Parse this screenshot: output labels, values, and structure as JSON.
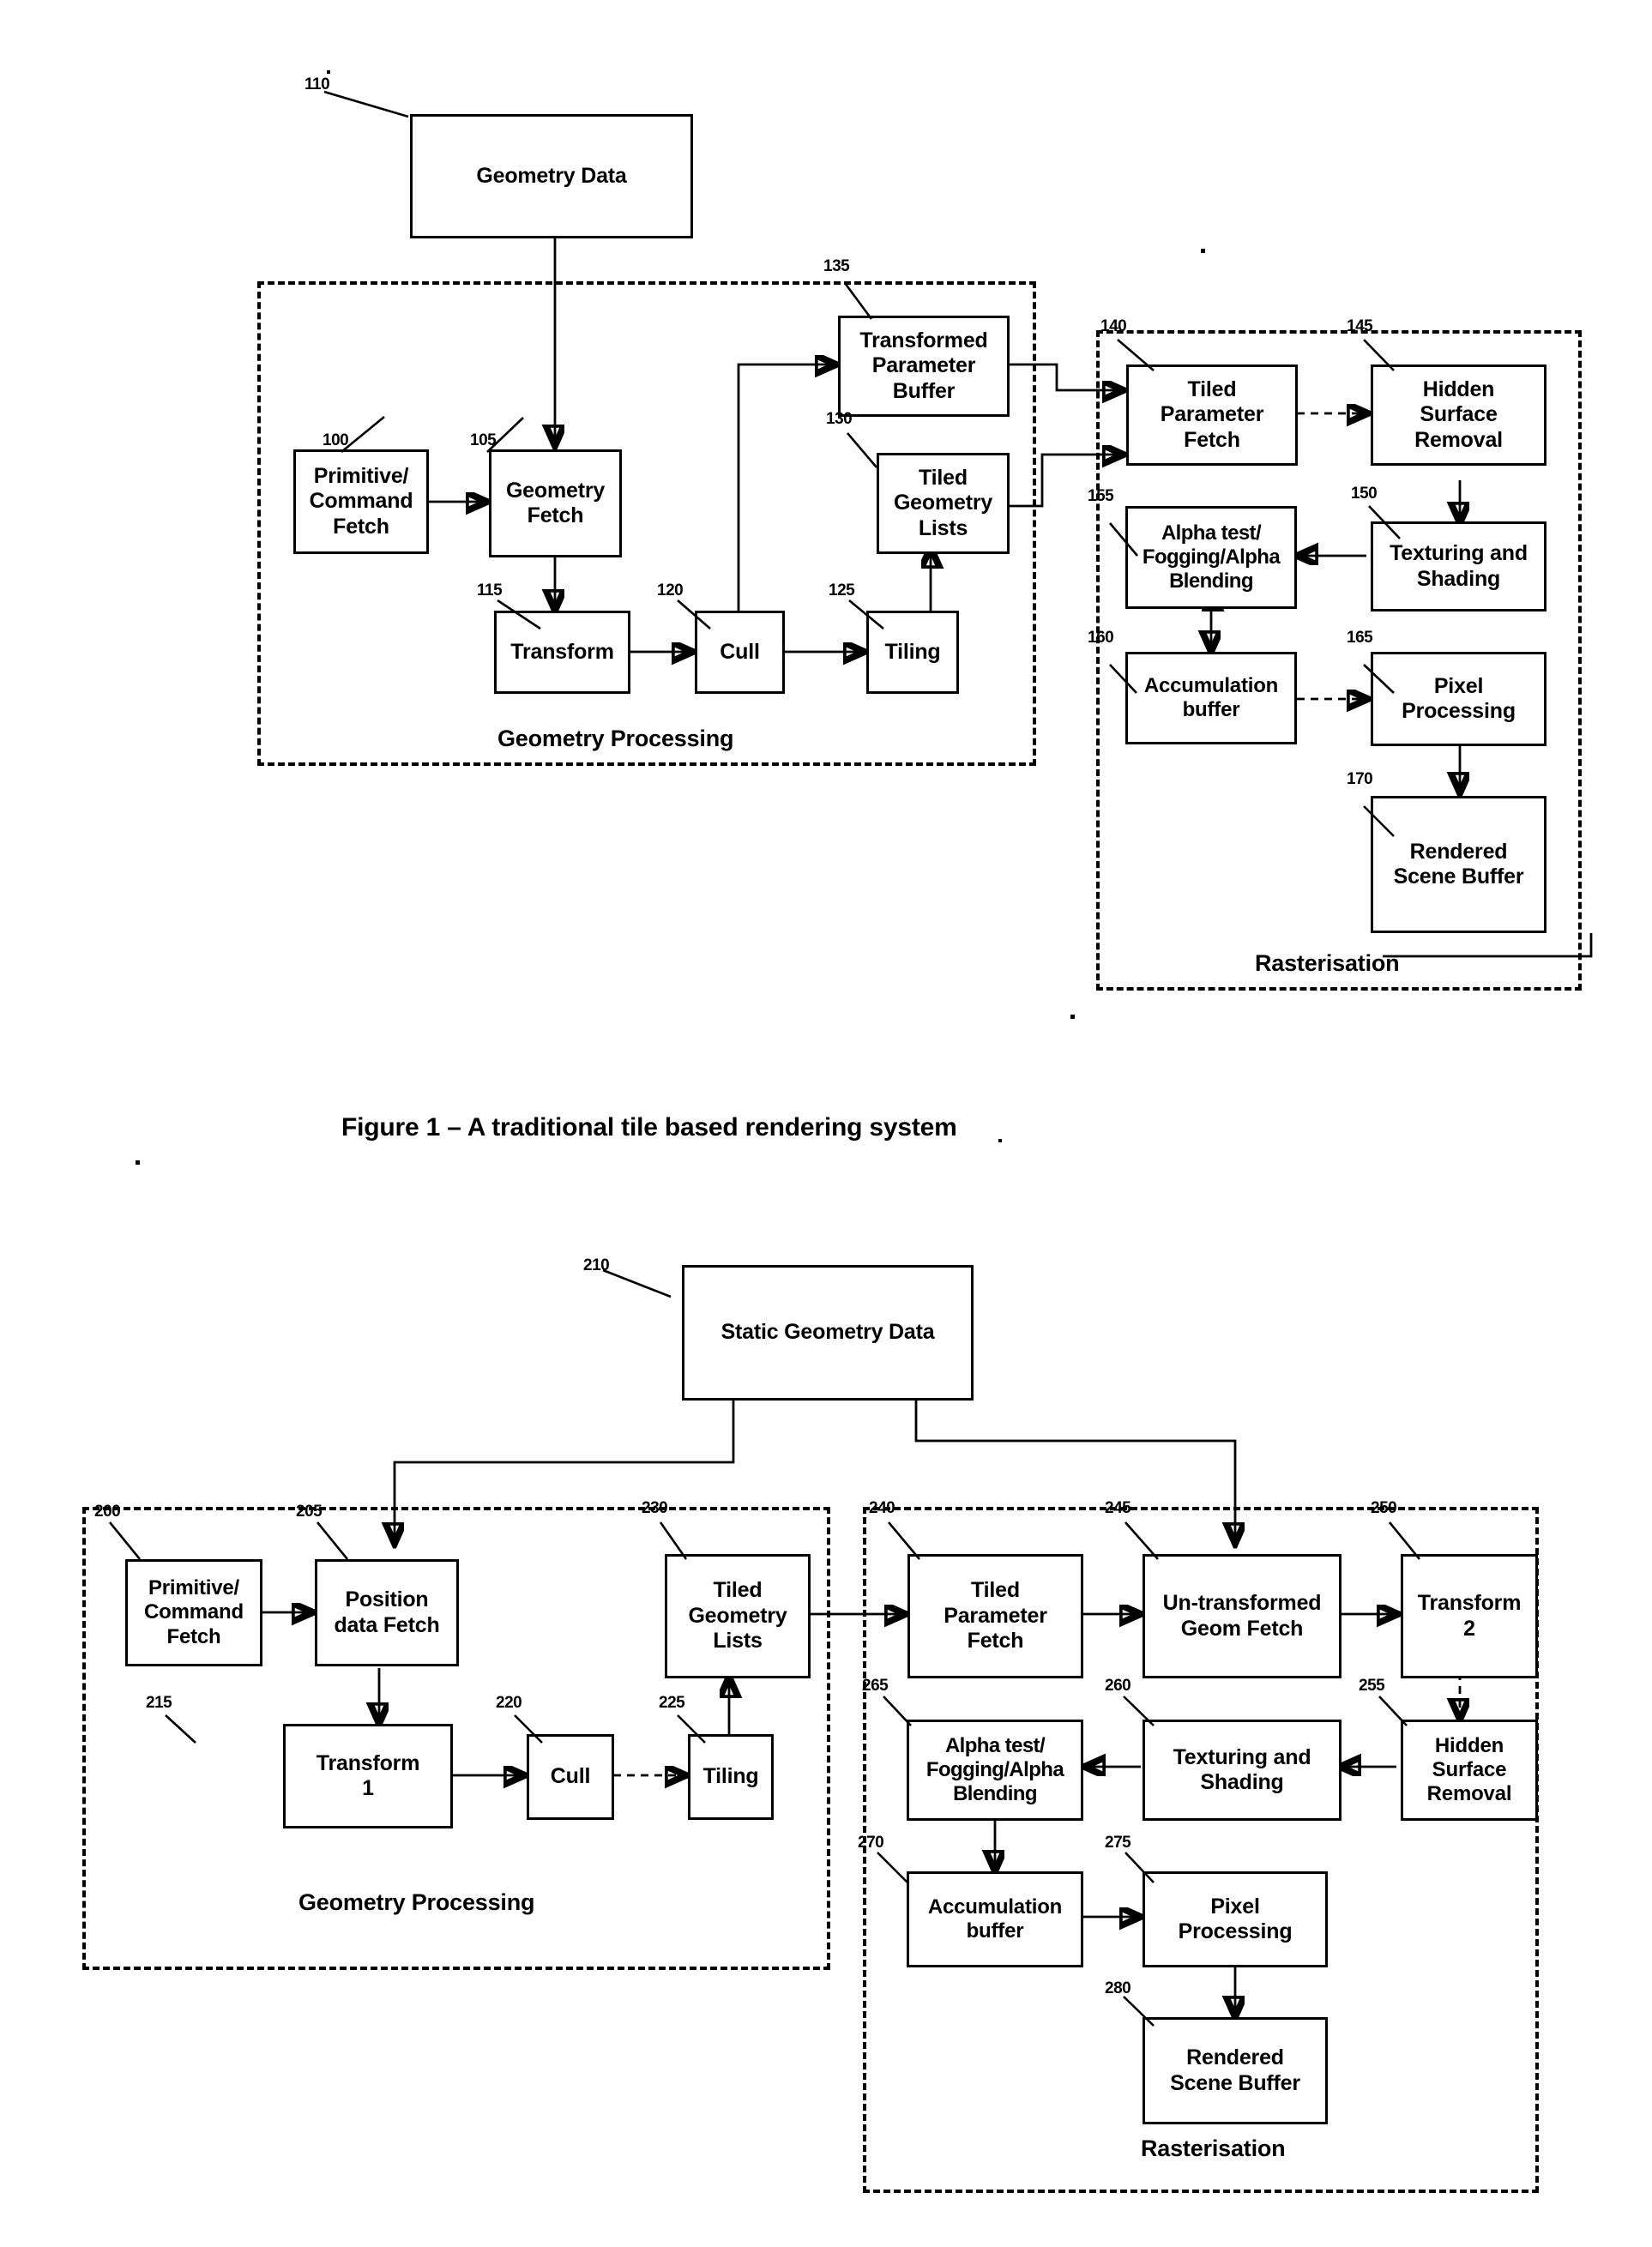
{
  "document": {
    "kind": "patent-figure-sheet",
    "figures": [
      {
        "id": "figure-1",
        "caption": "Figure 1 – A traditional tile based rendering system",
        "groups": [
          {
            "id": "geometry-processing",
            "label": "Geometry Processing"
          },
          {
            "id": "rasterisation",
            "label": "Rasterisation"
          }
        ],
        "blocks": [
          {
            "ref": "110",
            "label": "Geometry Data"
          },
          {
            "ref": "100",
            "label": "Primitive/\nCommand\nFetch"
          },
          {
            "ref": "105",
            "label": "Geometry\nFetch"
          },
          {
            "ref": "115",
            "label": "Transform"
          },
          {
            "ref": "120",
            "label": "Cull"
          },
          {
            "ref": "125",
            "label": "Tiling"
          },
          {
            "ref": "135",
            "label": "Transformed\nParameter\nBuffer"
          },
          {
            "ref": "130",
            "label": "Tiled\nGeometry\nLists"
          },
          {
            "ref": "140",
            "label": "Tiled\nParameter\nFetch"
          },
          {
            "ref": "145",
            "label": "Hidden\nSurface\nRemoval"
          },
          {
            "ref": "150",
            "label": "Texturing and\nShading"
          },
          {
            "ref": "155",
            "label": "Alpha test/\nFogging/Alpha\nBlending"
          },
          {
            "ref": "160",
            "label": "Accumulation\nbuffer"
          },
          {
            "ref": "165",
            "label": "Pixel\nProcessing"
          },
          {
            "ref": "170",
            "label": "Rendered\nScene Buffer"
          }
        ]
      },
      {
        "id": "figure-2",
        "caption": "",
        "groups": [
          {
            "id": "geometry-processing-2",
            "label": "Geometry Processing"
          },
          {
            "id": "rasterisation-2",
            "label": "Rasterisation"
          }
        ],
        "blocks": [
          {
            "ref": "210",
            "label": "Static Geometry Data"
          },
          {
            "ref": "200",
            "label": "Primitive/\nCommand\nFetch"
          },
          {
            "ref": "205",
            "label": "Position\ndata Fetch"
          },
          {
            "ref": "215",
            "label": "Transform\n1"
          },
          {
            "ref": "220",
            "label": "Cull"
          },
          {
            "ref": "225",
            "label": "Tiling"
          },
          {
            "ref": "230",
            "label": "Tiled\nGeometry\nLists"
          },
          {
            "ref": "240",
            "label": "Tiled\nParameter\nFetch"
          },
          {
            "ref": "245",
            "label": "Un-transformed\nGeom Fetch"
          },
          {
            "ref": "250",
            "label": "Transform\n2"
          },
          {
            "ref": "255",
            "label": "Hidden\nSurface\nRemoval"
          },
          {
            "ref": "260",
            "label": "Texturing and\nShading"
          },
          {
            "ref": "265",
            "label": "Alpha test/\nFogging/Alpha\nBlending"
          },
          {
            "ref": "270",
            "label": "Accumulation\nbuffer"
          },
          {
            "ref": "275",
            "label": "Pixel\nProcessing"
          },
          {
            "ref": "280",
            "label": "Rendered\nScene Buffer"
          }
        ]
      }
    ]
  },
  "fig1": {
    "caption": "Figure 1 – A traditional tile based rendering system",
    "group_geometry_label": "Geometry Processing",
    "group_raster_label": "Rasterisation",
    "b110": {
      "label": "Geometry Data",
      "ref": "110"
    },
    "b100": {
      "line1": "Primitive/",
      "line2": "Command",
      "line3": "Fetch",
      "ref": "100"
    },
    "b105": {
      "line1": "Geometry",
      "line2": "Fetch",
      "ref": "105"
    },
    "b115": {
      "label": "Transform",
      "ref": "115"
    },
    "b120": {
      "label": "Cull",
      "ref": "120"
    },
    "b125": {
      "label": "Tiling",
      "ref": "125"
    },
    "b135": {
      "line1": "Transformed",
      "line2": "Parameter",
      "line3": "Buffer",
      "ref": "135"
    },
    "b130": {
      "line1": "Tiled",
      "line2": "Geometry",
      "line3": "Lists",
      "ref": "130"
    },
    "b140": {
      "line1": "Tiled",
      "line2": "Parameter",
      "line3": "Fetch",
      "ref": "140"
    },
    "b145": {
      "line1": "Hidden",
      "line2": "Surface",
      "line3": "Removal",
      "ref": "145"
    },
    "b150": {
      "line1": "Texturing and",
      "line2": "Shading",
      "ref": "150"
    },
    "b155": {
      "line1": "Alpha test/",
      "line2": "Fogging/Alpha",
      "line3": "Blending",
      "ref": "155"
    },
    "b160": {
      "line1": "Accumulation",
      "line2": "buffer",
      "ref": "160"
    },
    "b165": {
      "line1": "Pixel",
      "line2": "Processing",
      "ref": "165"
    },
    "b170": {
      "line1": "Rendered",
      "line2": "Scene Buffer",
      "ref": "170"
    }
  },
  "fig2": {
    "group_geometry_label": "Geometry Processing",
    "group_raster_label": "Rasterisation",
    "b210": {
      "label": "Static Geometry Data",
      "ref": "210"
    },
    "b200": {
      "line1": "Primitive/",
      "line2": "Command",
      "line3": "Fetch",
      "ref": "200"
    },
    "b205": {
      "line1": "Position",
      "line2": "data Fetch",
      "ref": "205"
    },
    "b215": {
      "line1": "Transform",
      "line2": "1",
      "ref": "215"
    },
    "b220": {
      "label": "Cull",
      "ref": "220"
    },
    "b225": {
      "label": "Tiling",
      "ref": "225"
    },
    "b230": {
      "line1": "Tiled",
      "line2": "Geometry",
      "line3": "Lists",
      "ref": "230"
    },
    "b240": {
      "line1": "Tiled",
      "line2": "Parameter",
      "line3": "Fetch",
      "ref": "240"
    },
    "b245": {
      "line1": "Un-transformed",
      "line2": "Geom Fetch",
      "ref": "245"
    },
    "b250": {
      "line1": "Transform",
      "line2": "2",
      "ref": "250"
    },
    "b255": {
      "line1": "Hidden",
      "line2": "Surface",
      "line3": "Removal",
      "ref": "255"
    },
    "b260": {
      "line1": "Texturing and",
      "line2": "Shading",
      "ref": "260"
    },
    "b265": {
      "line1": "Alpha test/",
      "line2": "Fogging/Alpha",
      "line3": "Blending",
      "ref": "265"
    },
    "b270": {
      "line1": "Accumulation",
      "line2": "buffer",
      "ref": "270"
    },
    "b275": {
      "line1": "Pixel",
      "line2": "Processing",
      "ref": "275"
    },
    "b280": {
      "line1": "Rendered",
      "line2": "Scene Buffer",
      "ref": "280"
    }
  }
}
